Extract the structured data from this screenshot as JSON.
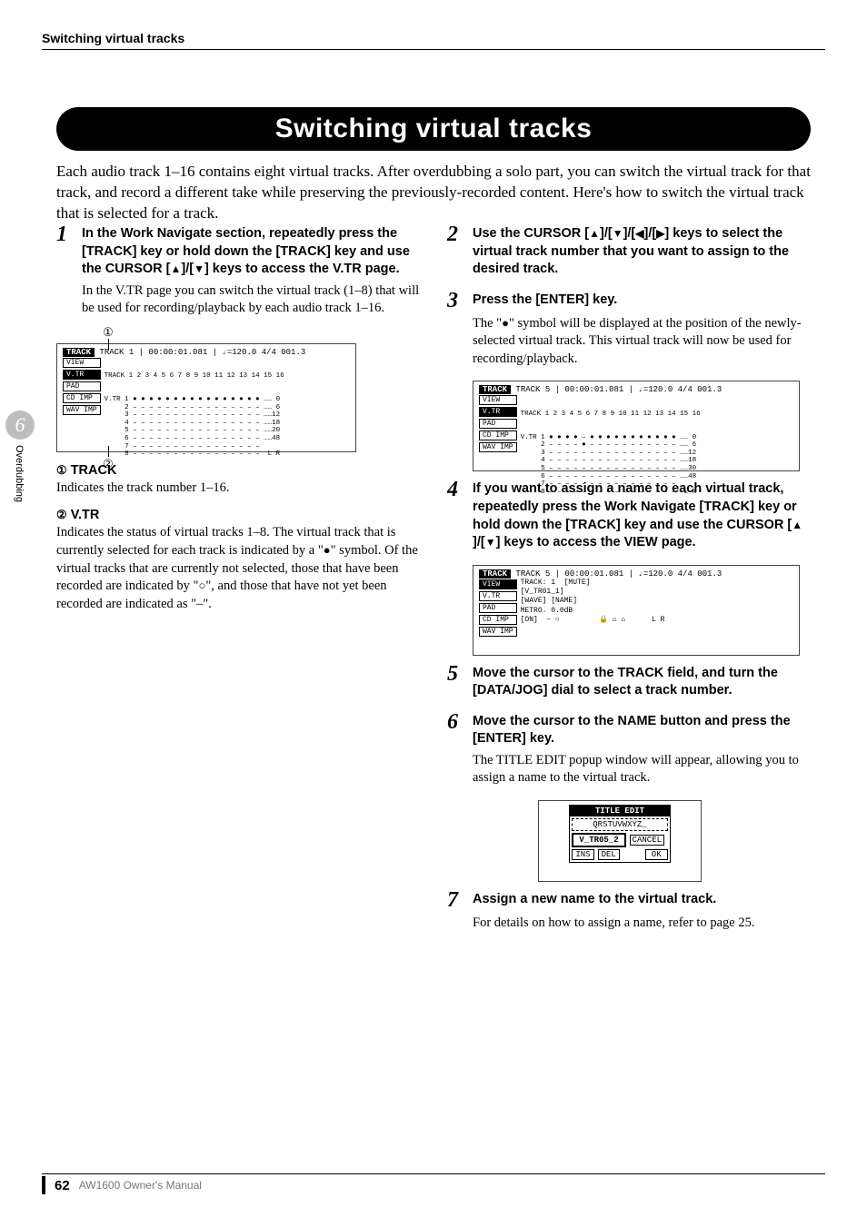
{
  "running_head": "Switching virtual tracks",
  "page_title": "Switching virtual tracks",
  "intro": "Each audio track 1–16 contains eight virtual tracks. After overdubbing a solo part, you can switch the virtual track for that track, and record a different take while preserving the previously-recorded content. Here's how to switch the virtual track that is selected for a track.",
  "side": {
    "chapter": "6",
    "label": "Overdubbing"
  },
  "footer": {
    "page": "62",
    "doc": "AW1600 Owner's Manual"
  },
  "glyph": {
    "up": "▲",
    "down": "▼",
    "left": "◀",
    "right": "▶",
    "filled": "●",
    "hollow": "○",
    "circ1": "①",
    "circ2": "②"
  },
  "step1": {
    "num": "1",
    "title_a": "In the Work Navigate section, repeatedly press the [TRACK] key or hold down the [TRACK] key and use the CURSOR [",
    "title_b": "]/[",
    "title_c": "] keys to access the V.TR page.",
    "body": "In the V.TR page you can switch the virtual track (1–8) that will be used for recording/playback by each audio track 1–16."
  },
  "def1": {
    "head": "TRACK",
    "body": "Indicates the track number 1–16."
  },
  "def2": {
    "head": "V.TR",
    "body_a": "Indicates the status of virtual tracks 1–8. The virtual track that is currently selected for each track is indicated by a \"",
    "body_b": "\" symbol. Of the virtual tracks that are currently not selected, those that have been recorded are indicated by \"",
    "body_c": "\", and those that have not yet been recorded are indicated as \"–\"."
  },
  "step2": {
    "num": "2",
    "title_a": "Use the CURSOR [",
    "title_b": "]/[",
    "title_c": "]/[",
    "title_d": "]/[",
    "title_e": "] keys to select the virtual track number that you want to assign to the desired track."
  },
  "step3": {
    "num": "3",
    "title": "Press the [ENTER] key.",
    "body_a": "The \"",
    "body_b": "\" symbol will be displayed at the position of the newly-selected virtual track. This virtual track will now be used for recording/playback."
  },
  "step4": {
    "num": "4",
    "title_a": "If you want to assign a name to each virtual track, repeatedly press the Work Navigate [TRACK] key or hold down the [TRACK] key and use the CURSOR [",
    "title_b": "]/[",
    "title_c": "] keys to access the VIEW page."
  },
  "step5": {
    "num": "5",
    "title": "Move the cursor to the TRACK field, and turn the [DATA/JOG] dial to select a track number."
  },
  "step6": {
    "num": "6",
    "title": "Move the cursor to the NAME button and press the [ENTER] key.",
    "body": "The TITLE EDIT popup window will appear, allowing you to assign a name to the virtual track."
  },
  "step7": {
    "num": "7",
    "title": "Assign a new name to the virtual track.",
    "body": "For details on how to assign a name, refer to page 25."
  },
  "screens": {
    "s1": {
      "header": "TRACK",
      "topbar": "TRACK   1   |   00:00:01.081   |  ♩=120.0  4/4  001.3",
      "tabs": [
        "VIEW",
        "V.TR",
        "PAD",
        "CD IMP",
        "WAV IMP"
      ],
      "sel": "V.TR",
      "cols": "TRACK 1 2 3 4 5 6 7 8 9 10 11 12 13 14 15 16",
      "rows": "V.TR 1 ● ● ● ● ● ● ● ● ● ● ● ● ● ● ● ● …… 0\n     2 – – – – – – – – – – – – – – – – …… 6\n     3 – – – – – – – – – – – – – – – – ……12\n     4 – – – – – – – – – – – – – – – – ……18\n     5 – – – – – – – – – – – – – – – – ……20\n     6 – – – – – – – – – – – – – – – – ……48\n     7 – – – – – – – – – – – – – – – –\n     8 – – – – – – – – – – – – – – – –  L R"
    },
    "s2": {
      "header": "TRACK",
      "topbar": "TRACK   5   |   00:00:01.081   |  ♩=120.0  4/4  001.3",
      "tabs": [
        "VIEW",
        "V.TR",
        "PAD",
        "CD IMP",
        "WAV IMP"
      ],
      "sel": "V.TR",
      "cols": "TRACK 1 2 3 4 5 6 7 8 9 10 11 12 13 14 15 16",
      "rows": "V.TR 1 ● ● ● ● – ● ● ● ● ● ● ● ● ● ● ● …… 0\n     2 – – – – ● – – – – – – – – – – – …… 6\n     3 – – – – – – – – – – – – – – – – ……12\n     4 – – – – – – – – – – – – – – – – ……18\n     5 – – – – – – – – – – – – – – – – ……30\n     6 – – – – – – – – – – – – – – – – ……48\n     7 – – – – – – – – – – – – – – – –\n     8 – – – – – – – – – – – – – – – –  L R"
    },
    "s3": {
      "header": "TRACK",
      "topbar": "TRACK   5   |   00:00:01.081   |  ♩=120.0  4/4  001.3",
      "tabs": [
        "VIEW",
        "V.TR",
        "PAD",
        "CD IMP",
        "WAV IMP"
      ],
      "sel": "VIEW",
      "body": "TRACK: 1  [MUTE]\n[V_TR01_1]\n[WAVE] [NAME]\nMETRO. 0.0dB\n[ON]  – ○         🔒 ⌂ ⌂      L R"
    },
    "s4": {
      "title": "TITLE EDIT",
      "row1": "QRSTUVWXYZ_",
      "row2": "V_TR05_2",
      "btn_cancel": "CANCEL",
      "btn_ok": "OK",
      "btn_ins": "INS",
      "btn_del": "DEL"
    }
  }
}
